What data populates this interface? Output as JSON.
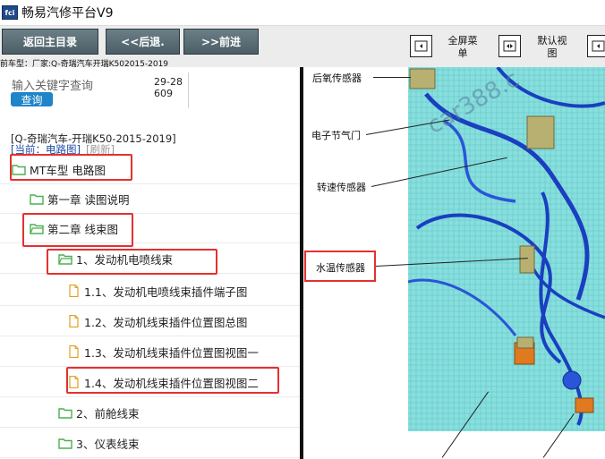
{
  "window": {
    "title": "畅易汽修平台V9",
    "icon_text": "fci"
  },
  "toolbar": {
    "home_label": "返回主目录",
    "back_label": "<<后退.",
    "forward_label": ">>前进",
    "fullscreen_label": "全屏菜单",
    "default_view_label": "默认视图"
  },
  "model_line": "前车型：厂家:Q-奇瑞汽车开瑞K502015-2019",
  "search": {
    "placeholder": "输入关键字查询",
    "button_label": "查询",
    "code": "29-28609"
  },
  "breadcrumb": {
    "line1": "[Q-奇瑞汽车-开瑞K50-2015-2019]",
    "current_label": "[当前：电路图]",
    "refresh_label": "[刷新]"
  },
  "tree": [
    {
      "label": "MT车型 电路图",
      "type": "folder",
      "highlighted": true
    },
    {
      "label": "第一章 读图说明",
      "type": "folder",
      "highlighted": false
    },
    {
      "label": "第二章 线束图",
      "type": "folder",
      "highlighted": true
    },
    {
      "label": "1、发动机电喷线束",
      "type": "folder",
      "highlighted": true
    },
    {
      "label": "1.1、发动机电喷线束插件端子图",
      "type": "file",
      "highlighted": false
    },
    {
      "label": "1.2、发动机线束插件位置图总图",
      "type": "file",
      "highlighted": false
    },
    {
      "label": "1.3、发动机线束插件位置图视图一",
      "type": "file",
      "highlighted": false
    },
    {
      "label": "1.4、发动机线束插件位置图视图二",
      "type": "file",
      "highlighted": true
    },
    {
      "label": "2、前舱线束",
      "type": "folder",
      "highlighted": false
    },
    {
      "label": "3、仪表线束",
      "type": "folder",
      "highlighted": false
    }
  ],
  "diagram": {
    "watermark": "car388.c",
    "callouts": [
      "后氧传感器",
      "电子节气门",
      "转速传感器",
      "水温传感器"
    ]
  },
  "colors": {
    "highlight": "#e53030",
    "nav_button": "#5a6c74",
    "search_button": "#1f84c8",
    "folder_icon": "#4caf50",
    "file_icon": "#e0a020",
    "harness": "#1a3fc0",
    "diagram_bg": "#7fd8d8"
  }
}
